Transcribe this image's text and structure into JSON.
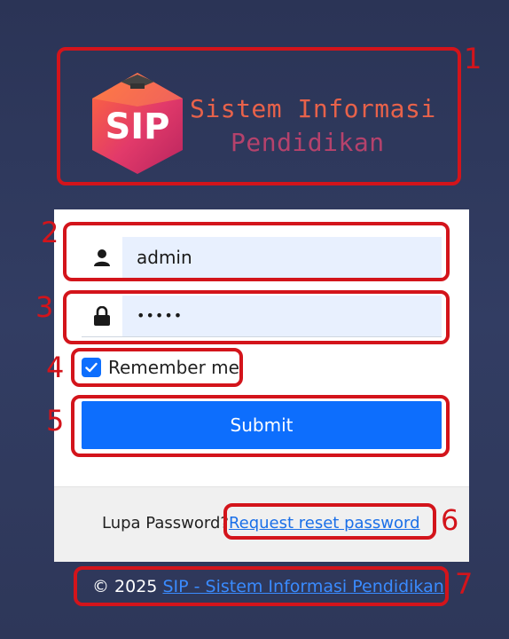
{
  "logo": {
    "badge_text": "SIP",
    "line1": "Sistem Informasi",
    "line2": "Pendidikan"
  },
  "form": {
    "username_value": "admin",
    "password_value": "•••••",
    "remember_label": "Remember me",
    "remember_checked": true,
    "submit_label": "Submit"
  },
  "footer": {
    "reset_prefix": "Lupa Password?",
    "reset_link": "Request reset password"
  },
  "copyright": {
    "prefix": "© 2025",
    "link": "SIP - Sistem Informasi Pendidikan"
  },
  "annotations": [
    "1",
    "2",
    "3",
    "4",
    "5",
    "6",
    "7"
  ],
  "colors": {
    "background": "#2e3759",
    "annotation": "#d3141b",
    "primary": "#0d6efd",
    "input_bg": "#e8f0fe",
    "logo_orange": "#e8624a",
    "logo_pink": "#b5426c"
  }
}
